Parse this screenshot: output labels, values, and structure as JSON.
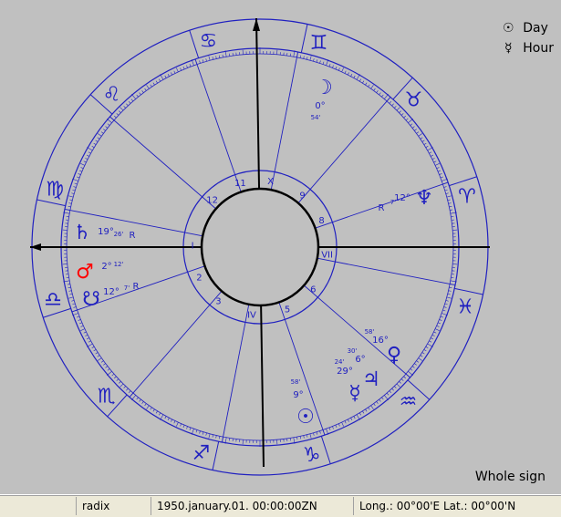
{
  "legend": {
    "items": [
      {
        "icon": "sun-icon",
        "glyph": "☉",
        "label": "Day"
      },
      {
        "icon": "mercury-icon",
        "glyph": "☿",
        "label": "Hour"
      }
    ]
  },
  "house_system": "Whole sign",
  "statusbar": {
    "cell1": "",
    "cell2": "radix",
    "cell3": "1950.january.01. 00:00:00ZN",
    "cell4": "Long.: 00°00'E Lat.: 00°00'N"
  },
  "colors": {
    "background": "#c0c0c0",
    "wheel": "#2020c0",
    "axes": "#000000",
    "mars": "#ff0000"
  },
  "signs": [
    {
      "name": "gemini",
      "glyph": "♊"
    },
    {
      "name": "taurus",
      "glyph": "♉"
    },
    {
      "name": "aries",
      "glyph": "♈"
    },
    {
      "name": "pisces",
      "glyph": "♓"
    },
    {
      "name": "aquarius",
      "glyph": "♒"
    },
    {
      "name": "capricorn",
      "glyph": "♑"
    },
    {
      "name": "sagittarius",
      "glyph": "♐"
    },
    {
      "name": "scorpio",
      "glyph": "♏"
    },
    {
      "name": "libra",
      "glyph": "♎"
    },
    {
      "name": "virgo",
      "glyph": "♍"
    },
    {
      "name": "leo",
      "glyph": "♌"
    },
    {
      "name": "cancer",
      "glyph": "♋"
    }
  ],
  "houses": [
    "I",
    "2",
    "3",
    "IV",
    "5",
    "6",
    "VII",
    "8",
    "9",
    "X",
    "11",
    "12"
  ],
  "planets": [
    {
      "name": "moon",
      "glyph": "☽",
      "deg": "0°",
      "min": "54'",
      "retro": ""
    },
    {
      "name": "neptune",
      "glyph": "♆",
      "deg": "12°",
      "min": "7'",
      "retro": "R"
    },
    {
      "name": "venus",
      "glyph": "♀",
      "deg": "16°",
      "min": "58'",
      "retro": ""
    },
    {
      "name": "jupiter",
      "glyph": "♃",
      "deg": "6°",
      "min": "30'",
      "retro": ""
    },
    {
      "name": "mercury",
      "glyph": "☿",
      "deg": "29°",
      "min": "24'",
      "retro": ""
    },
    {
      "name": "sun",
      "glyph": "☉",
      "deg": "9°",
      "min": "58'",
      "retro": ""
    },
    {
      "name": "node",
      "glyph": "☋",
      "deg": "12°",
      "min": "7'",
      "retro": "R"
    },
    {
      "name": "mars",
      "glyph": "♂",
      "deg": "2°",
      "min": "12'",
      "retro": ""
    },
    {
      "name": "saturn",
      "glyph": "♄",
      "deg": "19°",
      "min": "26'",
      "retro": "R"
    }
  ]
}
